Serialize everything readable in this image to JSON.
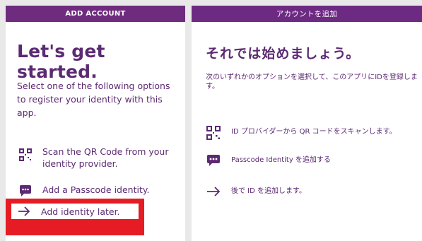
{
  "english": {
    "header": "ADD ACCOUNT",
    "title": "Let's get started.",
    "description": "Select one of the following options to register your identity with this app.",
    "options": [
      {
        "icon": "qr-code-icon",
        "label": "Scan the QR Code from your identity provider."
      },
      {
        "icon": "chat-bubble-icon",
        "label": "Add a Passcode identity."
      },
      {
        "icon": "arrow-right-icon",
        "label": "Add identity later."
      }
    ]
  },
  "japanese": {
    "header": "アカウントを追加",
    "title": "それでは始めましょう。",
    "description": "次のいずれかのオプションを選択して、このアプリにIDを登録します。",
    "options": [
      {
        "icon": "qr-code-icon",
        "label": "ID プロバイダーから QR コードをスキャンします。"
      },
      {
        "icon": "chat-bubble-icon",
        "label": "Passcode Identity を追加する"
      },
      {
        "icon": "arrow-right-icon",
        "label": "後で ID を追加します。"
      }
    ]
  },
  "colors": {
    "header": "#6f2c7f",
    "text": "#5c2a72",
    "highlight": "#e51c23"
  }
}
